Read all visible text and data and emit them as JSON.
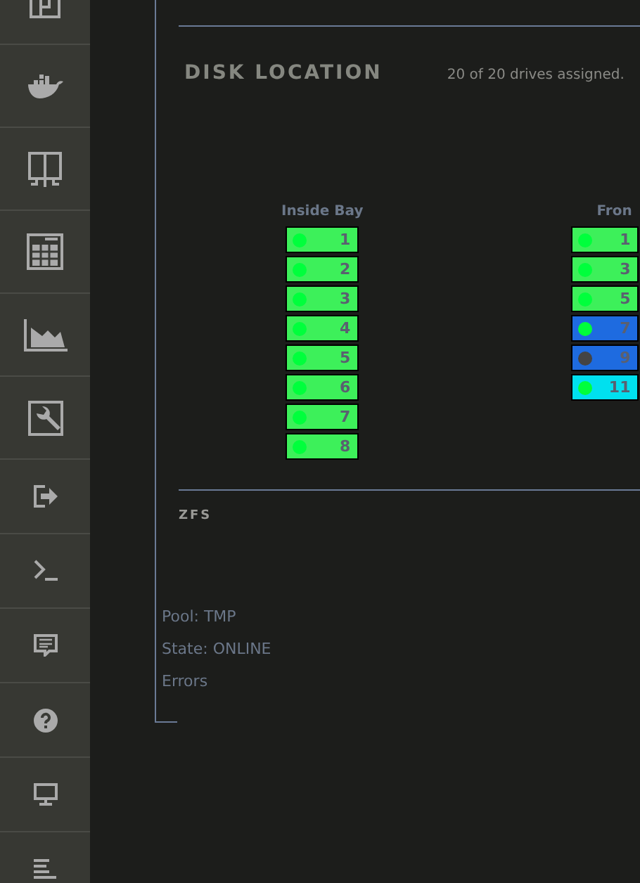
{
  "sidebar": {
    "items": [
      {
        "kind": "plugin"
      },
      {
        "kind": "docker"
      },
      {
        "kind": "vms"
      },
      {
        "kind": "apps"
      },
      {
        "kind": "stats"
      },
      {
        "kind": "tools"
      },
      {
        "kind": "logout"
      },
      {
        "kind": "terminal"
      },
      {
        "kind": "feedback"
      },
      {
        "kind": "help"
      },
      {
        "kind": "monitor"
      },
      {
        "kind": "log"
      }
    ]
  },
  "disk_location": {
    "title": "DISK LOCATION",
    "summary": "20 of 20 drives assigned.",
    "bays": [
      {
        "label": "Inside Bay",
        "drives": [
          {
            "number": "1",
            "color": "#3df05a",
            "led_on": true
          },
          {
            "number": "2",
            "color": "#3df05a",
            "led_on": true
          },
          {
            "number": "3",
            "color": "#3df05a",
            "led_on": true
          },
          {
            "number": "4",
            "color": "#3df05a",
            "led_on": true
          },
          {
            "number": "5",
            "color": "#3df05a",
            "led_on": true
          },
          {
            "number": "6",
            "color": "#3df05a",
            "led_on": true
          },
          {
            "number": "7",
            "color": "#3df05a",
            "led_on": true
          },
          {
            "number": "8",
            "color": "#3df05a",
            "led_on": true
          }
        ]
      },
      {
        "label": "Fron",
        "drives": [
          {
            "number": "1",
            "color": "#3df05a",
            "led_on": true
          },
          {
            "number": "3",
            "color": "#3df05a",
            "led_on": true
          },
          {
            "number": "5",
            "color": "#3df05a",
            "led_on": true
          },
          {
            "number": "7",
            "color": "#1e6be0",
            "led_on": true
          },
          {
            "number": "9",
            "color": "#1e6be0",
            "led_on": false
          },
          {
            "number": "11",
            "color": "#00e0ef",
            "led_on": true
          }
        ]
      }
    ]
  },
  "zfs": {
    "title": "ZFS",
    "lines": [
      "Pool: TMP",
      "State: ONLINE",
      "Errors"
    ]
  }
}
